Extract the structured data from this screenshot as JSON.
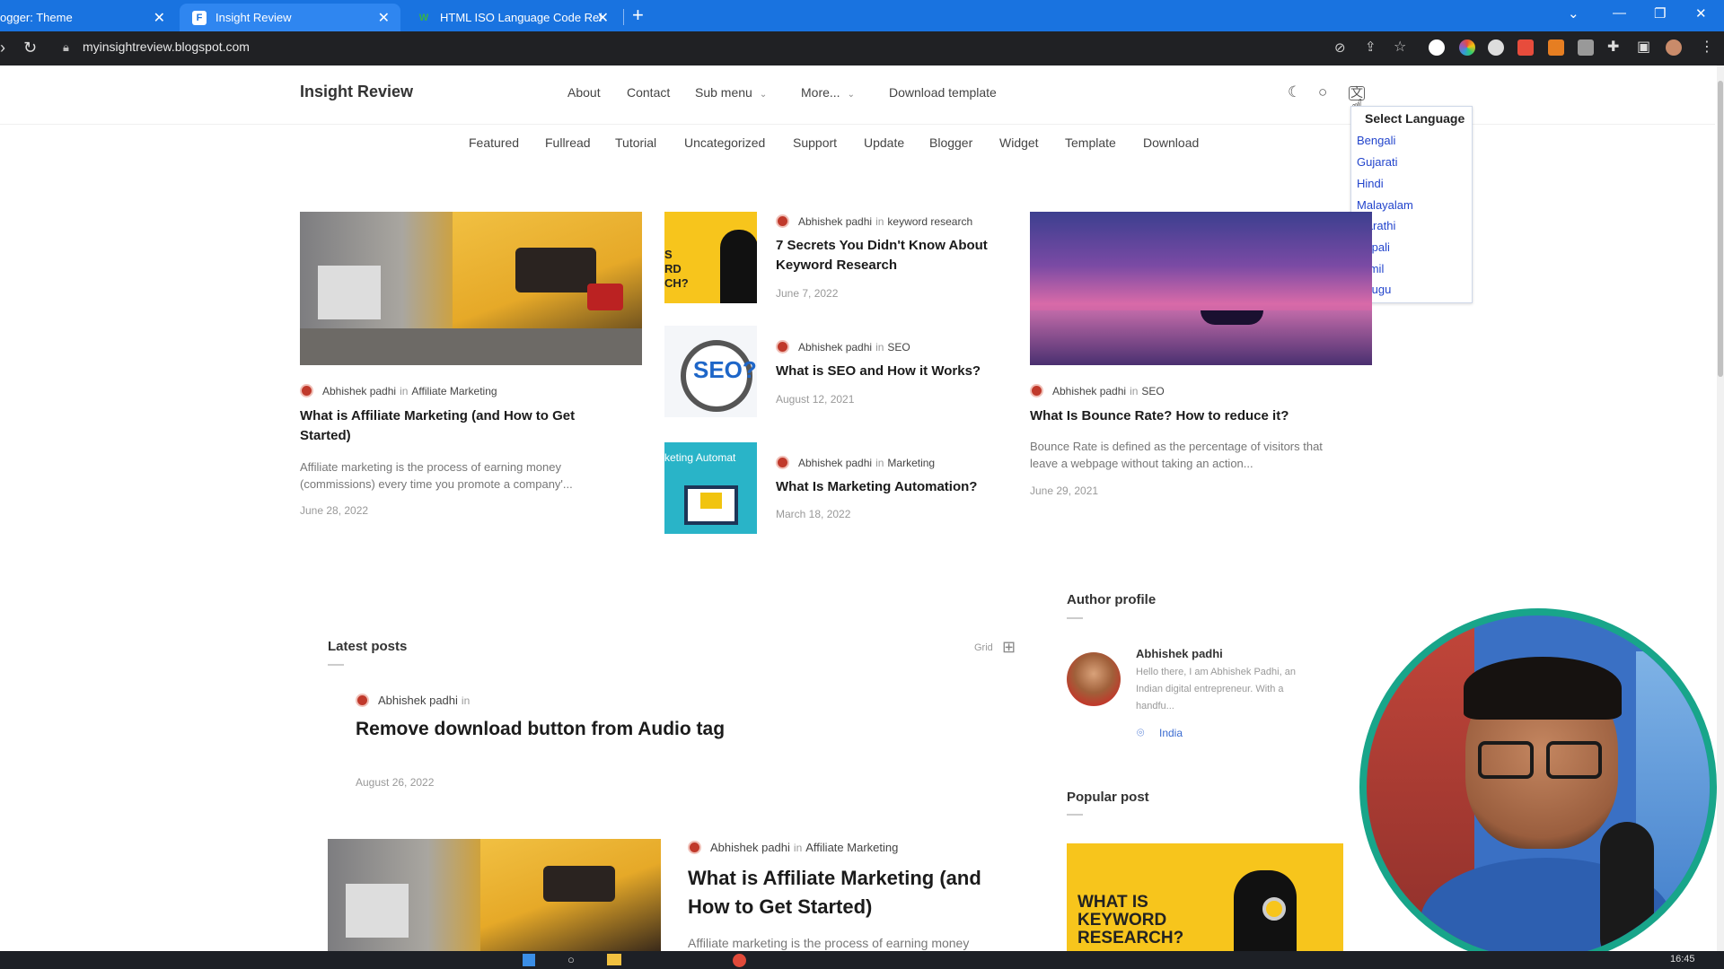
{
  "browser": {
    "tabs": [
      {
        "title": "ogger: Theme",
        "active": false
      },
      {
        "title": "Insight Review",
        "active": true
      },
      {
        "title": "HTML ISO Language Code Refer",
        "active": false
      }
    ],
    "url": "myinsightreview.blogspot.com"
  },
  "header": {
    "brand": "Insight Review",
    "nav": [
      {
        "label": "About"
      },
      {
        "label": "Contact"
      },
      {
        "label": "Sub menu"
      },
      {
        "label": "More..."
      },
      {
        "label": "Download template"
      }
    ],
    "categories": [
      "Featured",
      "Fullread",
      "Tutorial",
      "Uncategorized",
      "Support",
      "Update",
      "Blogger",
      "Widget",
      "Template",
      "Download"
    ]
  },
  "language_dropdown": {
    "title": "Select Language",
    "options": [
      "Bengali",
      "Gujarati",
      "Hindi",
      "Malayalam",
      "Marathi",
      "Nepali",
      "Tamil",
      "Telugu"
    ]
  },
  "featured": {
    "left": {
      "author": "Abhishek padhi",
      "in": "in",
      "category": "Affiliate Marketing",
      "title_line1": "What is Affiliate Marketing (and How to Get",
      "title_line2": "Started)",
      "excerpt_line1": "Affiliate marketing is the process of earning money",
      "excerpt_line2": "(commissions) every time you promote a company'...",
      "date": "June 28, 2022"
    },
    "middle": [
      {
        "author": "Abhishek padhi",
        "in": "in",
        "category": "keyword research",
        "title_line1": "7 Secrets You Didn't Know About",
        "title_line2": "Keyword Research",
        "date": "June 7, 2022",
        "thumb_text": "S\nRD\nCH?"
      },
      {
        "author": "Abhishek padhi",
        "in": "in",
        "category": "SEO",
        "title_line1": "What is SEO and How it Works?",
        "title_line2": "",
        "date": "August 12, 2021",
        "thumb_text": "SEO?"
      },
      {
        "author": "Abhishek padhi",
        "in": "in",
        "category": "Marketing",
        "title_line1": "What Is Marketing Automation?",
        "title_line2": "",
        "date": "March 18, 2022",
        "thumb_text": "keting Automat"
      }
    ],
    "right": {
      "author": "Abhishek padhi",
      "in": "in",
      "category": "SEO",
      "title": "What Is Bounce Rate? How to reduce it?",
      "excerpt_line1": "Bounce Rate is defined as the percentage of visitors that",
      "excerpt_line2": "leave a webpage without taking an action...",
      "date": "June 29, 2021"
    }
  },
  "latest": {
    "heading": "Latest posts",
    "grid_label": "Grid",
    "post1": {
      "author": "Abhishek padhi",
      "in": "in",
      "title": "Remove download button from Audio tag",
      "date": "August 26, 2022"
    },
    "post2": {
      "author": "Abhishek padhi",
      "in": "in",
      "category": "Affiliate Marketing",
      "title_line1": "What is Affiliate Marketing (and",
      "title_line2": "How to Get Started)",
      "excerpt": "Affiliate marketing is the process of earning money"
    }
  },
  "sidebar": {
    "author_heading": "Author profile",
    "author_name": "Abhishek padhi",
    "author_bio_line1": "Hello there, I am Abhishek Padhi, an",
    "author_bio_line2": "Indian digital entrepreneur. With a",
    "author_bio_line3": "handfu...",
    "location": "India",
    "popular_heading": "Popular post",
    "popular_image_text": "WHAT IS\nKEYWORD\nRESEARCH?"
  },
  "taskbar": {
    "time": "16:45"
  }
}
